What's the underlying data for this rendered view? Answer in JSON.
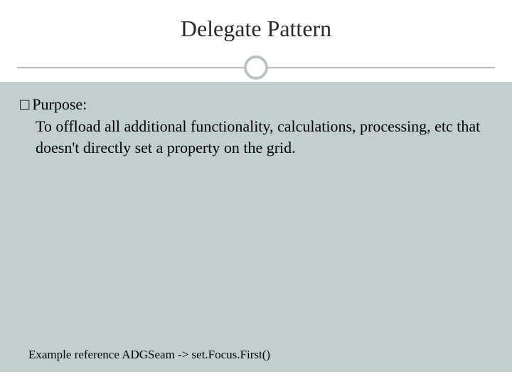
{
  "title": "Delegate Pattern",
  "bullet_glyph": "□",
  "purpose_label": "Purpose:",
  "body_text": "To offload all additional functionality, calculations, processing, etc that doesn't directly set a property on the grid.",
  "footer_reference": "Example reference  ADGSeam -> set.Focus.First()"
}
